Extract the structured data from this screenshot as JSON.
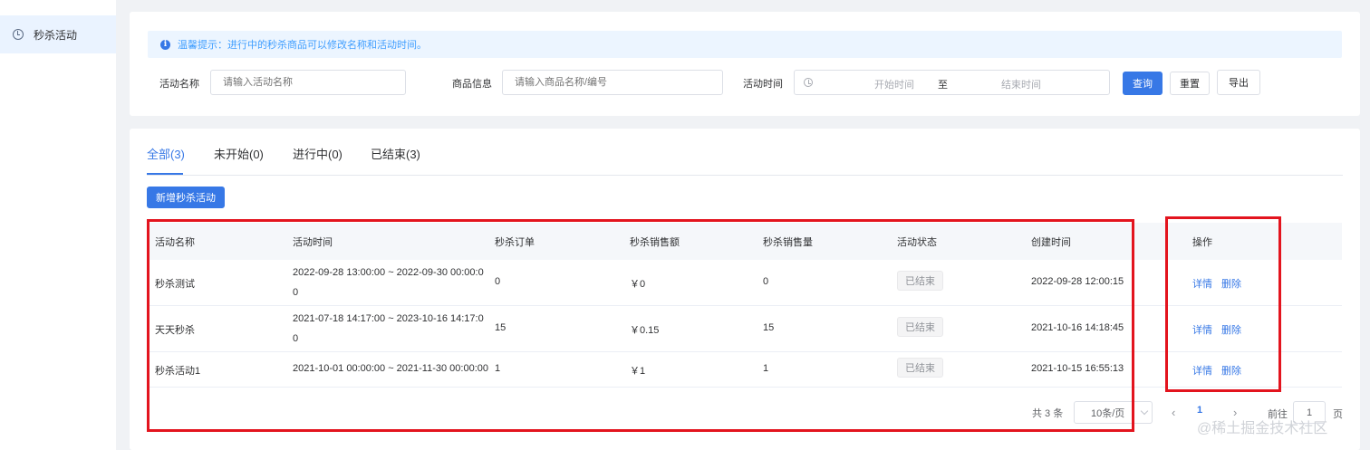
{
  "sidebar": {
    "items": [
      {
        "label": "秒杀活动",
        "icon": "clock-icon"
      }
    ]
  },
  "alert": {
    "text": "温馨提示：进行中的秒杀商品可以修改名称和活动时间。",
    "icon": "info-icon"
  },
  "filters": {
    "name_label": "活动名称",
    "name_placeholder": "请输入活动名称",
    "goods_label": "商品信息",
    "goods_placeholder": "请输入商品名称/编号",
    "time_label": "活动时间",
    "start_placeholder": "开始时间",
    "separator": "至",
    "end_placeholder": "结束时间",
    "search_label": "查询",
    "reset_label": "重置",
    "export_label": "导出"
  },
  "tabs": [
    {
      "label": "全部(3)",
      "active": true
    },
    {
      "label": "未开始(0)"
    },
    {
      "label": "进行中(0)"
    },
    {
      "label": "已结束(3)"
    }
  ],
  "add_button_label": "新增秒杀活动",
  "table": {
    "columns": [
      "活动名称",
      "活动时间",
      "秒杀订单",
      "秒杀销售额",
      "秒杀销售量",
      "活动状态",
      "创建时间",
      "操作"
    ],
    "rows": [
      {
        "name": "秒杀测试",
        "time_line1": "2022-09-28 13:00:00 ~ 2022-09-30 00:00:0",
        "time_line2": "0",
        "orders": "0",
        "sales": "￥0",
        "qty": "0",
        "status": "已结束",
        "created": "2022-09-28 12:00:15",
        "detail": "详情",
        "delete": "删除"
      },
      {
        "name": "天天秒杀",
        "time_line1": "2021-07-18 14:17:00 ~ 2023-10-16 14:17:0",
        "time_line2": "0",
        "orders": "15",
        "sales": "￥0.15",
        "qty": "15",
        "status": "已结束",
        "created": "2021-10-16 14:18:45",
        "detail": "详情",
        "delete": "删除"
      },
      {
        "name": "秒杀活动1",
        "time_line1": "2021-10-01 00:00:00 ~ 2021-11-30 00:00:00",
        "time_line2": "",
        "orders": "1",
        "sales": "￥1",
        "qty": "1",
        "status": "已结束",
        "created": "2021-10-15 16:55:13",
        "detail": "详情",
        "delete": "删除"
      }
    ]
  },
  "pagination": {
    "total": "共 3 条",
    "page_size": "10条/页",
    "current_page": "1",
    "goto_label": "前往",
    "goto_value": "1",
    "page_unit": "页",
    "prev": "‹",
    "next": "›"
  },
  "watermark": "@稀土掘金技术社区",
  "colors": {
    "primary": "#3778e6",
    "highlight_box": "#e3141e",
    "alert_bg": "#ecf5ff"
  }
}
